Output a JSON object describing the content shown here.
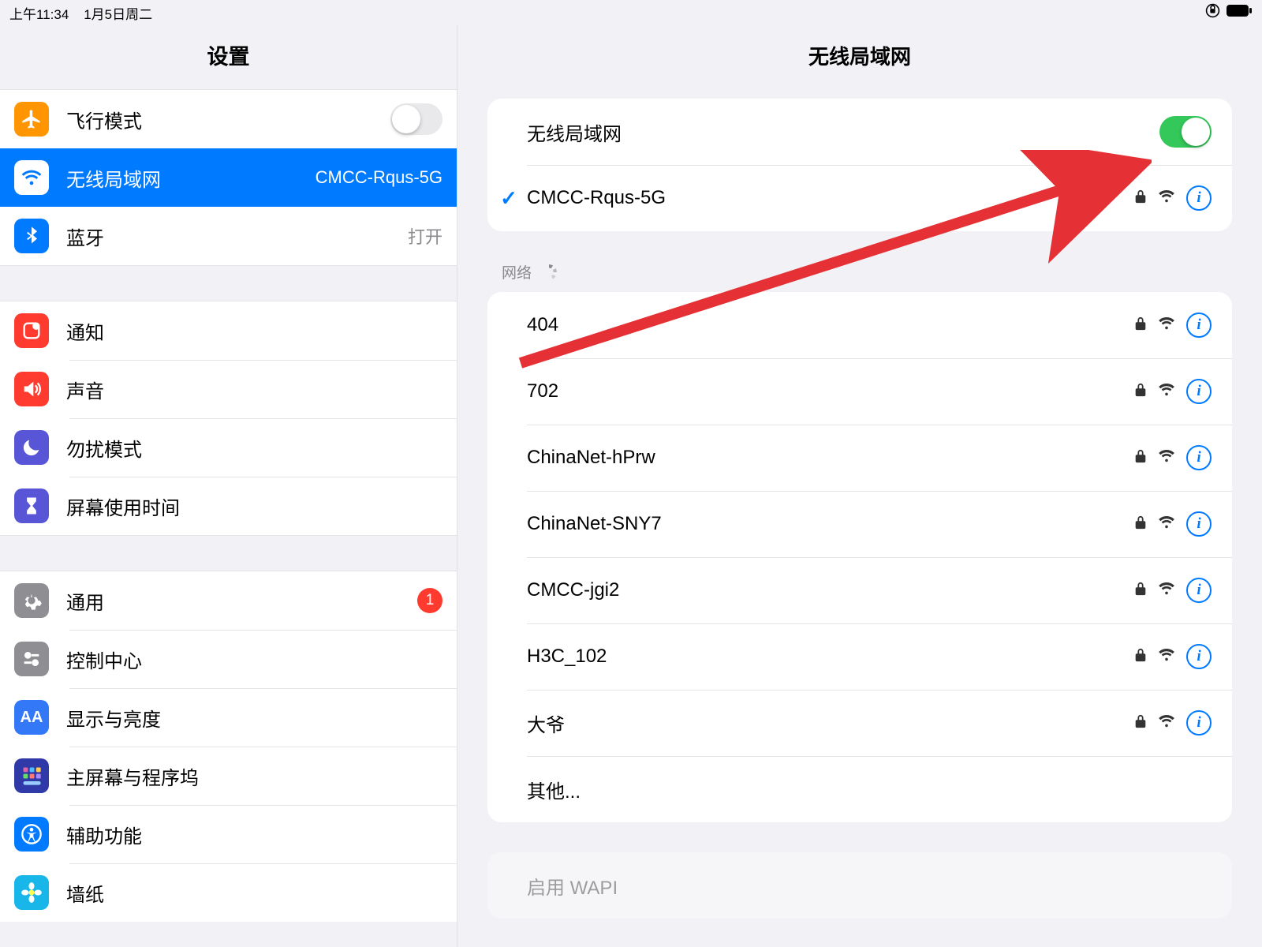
{
  "statusbar": {
    "time": "上午11:34",
    "date": "1月5日周二"
  },
  "sidebar": {
    "title": "设置",
    "group1": [
      {
        "id": "airplane",
        "label": "飞行模式",
        "icon": "airplane",
        "color": "ic-orange",
        "type": "switch",
        "on": false
      },
      {
        "id": "wifi",
        "label": "无线局域网",
        "icon": "wifi",
        "color": "ic-blue",
        "type": "drill",
        "tail": "CMCC-Rqus-5G",
        "selected": true
      },
      {
        "id": "bt",
        "label": "蓝牙",
        "icon": "bt",
        "color": "ic-blue",
        "type": "drill",
        "tail": "打开"
      }
    ],
    "group2": [
      {
        "id": "notif",
        "label": "通知",
        "icon": "notif",
        "color": "ic-red"
      },
      {
        "id": "sound",
        "label": "声音",
        "icon": "sound",
        "color": "ic-red"
      },
      {
        "id": "dnd",
        "label": "勿扰模式",
        "icon": "moon",
        "color": "ic-purple"
      },
      {
        "id": "screentime",
        "label": "屏幕使用时间",
        "icon": "hourglass",
        "color": "ic-purple"
      }
    ],
    "group3": [
      {
        "id": "general",
        "label": "通用",
        "icon": "gear",
        "color": "ic-gray",
        "badge": "1"
      },
      {
        "id": "control",
        "label": "控制中心",
        "icon": "sliders",
        "color": "ic-gray"
      },
      {
        "id": "display",
        "label": "显示与亮度",
        "icon": "AA",
        "color": "ic-lblue"
      },
      {
        "id": "home",
        "label": "主屏幕与程序坞",
        "icon": "grid",
        "color": "ic-dblue"
      },
      {
        "id": "access",
        "label": "辅助功能",
        "icon": "access",
        "color": "ic-bblue"
      },
      {
        "id": "wallpaper",
        "label": "墙纸",
        "icon": "flower",
        "color": "ic-bblue"
      }
    ]
  },
  "detail": {
    "title": "无线局域网",
    "toggle": {
      "label": "无线局域网",
      "on": true
    },
    "connected": {
      "ssid": "CMCC-Rqus-5G",
      "secured": true
    },
    "section_networks": "网络",
    "networks": [
      {
        "ssid": "404",
        "secured": true
      },
      {
        "ssid": "702",
        "secured": true
      },
      {
        "ssid": "ChinaNet-hPrw",
        "secured": true
      },
      {
        "ssid": "ChinaNet-SNY7",
        "secured": true
      },
      {
        "ssid": "CMCC-jgi2",
        "secured": true
      },
      {
        "ssid": "H3C_102",
        "secured": true
      },
      {
        "ssid": "大爷",
        "secured": true
      }
    ],
    "other_label": "其他...",
    "wapi_label": "启用 WAPI"
  }
}
